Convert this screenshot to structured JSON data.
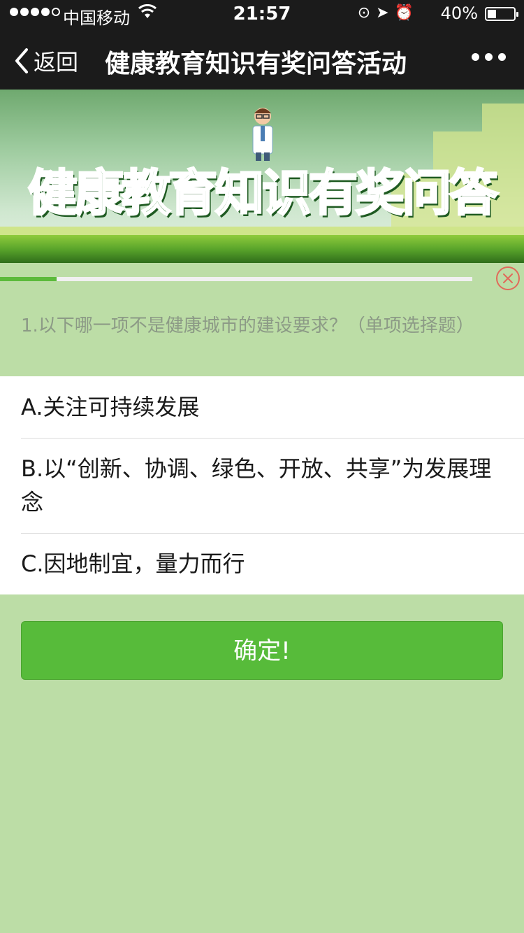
{
  "status_bar": {
    "carrier": "中国移动",
    "time": "21:57",
    "battery_percent": "40%",
    "battery_level": 0.4,
    "signal_bars_filled": 4,
    "signal_bars_total": 5
  },
  "nav": {
    "back_label": "返回",
    "title": "健康教育知识有奖问答活动"
  },
  "banner": {
    "title": "健康教育知识有奖问答"
  },
  "quiz": {
    "progress": 0.12,
    "question": "1.以下哪一项不是健康城市的建设要求？（单项选择题）",
    "options": [
      "A.关注可持续发展",
      "B.以“创新、协调、绿色、开放、共享”为发展理念",
      "C.因地制宜，量力而行"
    ],
    "confirm_label": "确定!"
  },
  "colors": {
    "background": "#bcdda6",
    "accent": "#57bb3a",
    "close": "#e16a5a"
  }
}
